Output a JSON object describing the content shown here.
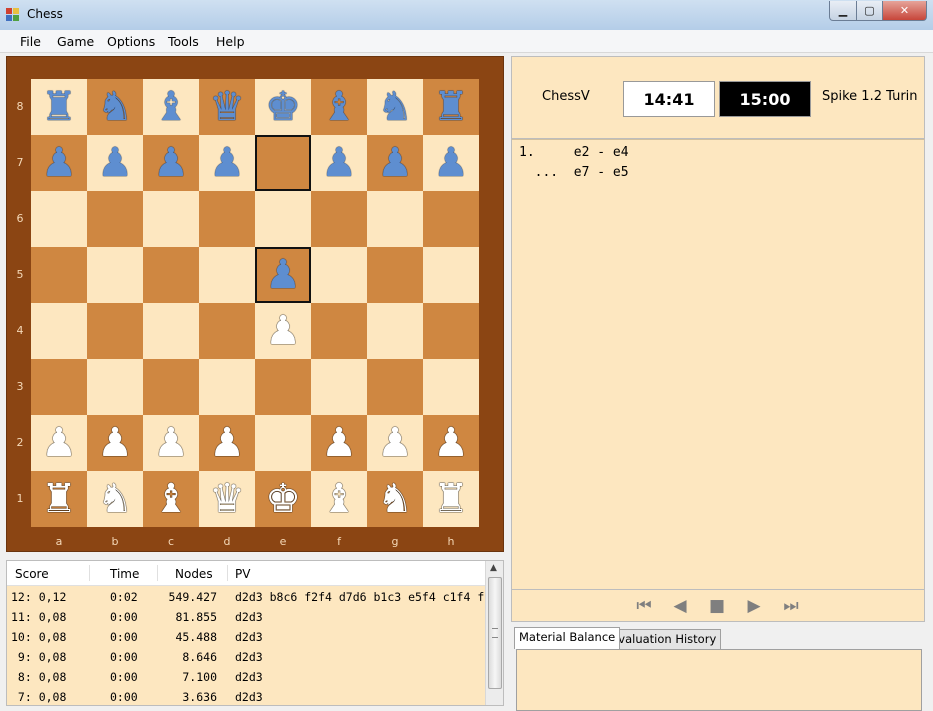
{
  "window": {
    "title": "Chess",
    "min_glyph": "▁",
    "max_glyph": "▢",
    "close_glyph": "✕"
  },
  "menu": [
    "File",
    "Game",
    "Options",
    "Tools",
    "Help"
  ],
  "board": {
    "ranks": [
      "8",
      "7",
      "6",
      "5",
      "4",
      "3",
      "2",
      "1"
    ],
    "files": [
      "a",
      "b",
      "c",
      "d",
      "e",
      "f",
      "g",
      "h"
    ],
    "colors": {
      "light": "#fde7c0",
      "dark": "#cf8741",
      "frame": "#8b4513",
      "black_piece": "#5e8ed0",
      "white_piece": "#ffffff"
    },
    "highlighted": [
      "e7",
      "e5"
    ],
    "pieces": {
      "a8": "b-rook",
      "b8": "b-knight",
      "c8": "b-bishop",
      "d8": "b-queen",
      "e8": "b-king",
      "f8": "b-bishop",
      "g8": "b-knight",
      "h8": "b-rook",
      "a7": "b-pawn",
      "b7": "b-pawn",
      "c7": "b-pawn",
      "d7": "b-pawn",
      "f7": "b-pawn",
      "g7": "b-pawn",
      "h7": "b-pawn",
      "e5": "b-pawn",
      "e4": "w-pawn",
      "a2": "w-pawn",
      "b2": "w-pawn",
      "c2": "w-pawn",
      "d2": "w-pawn",
      "f2": "w-pawn",
      "g2": "w-pawn",
      "h2": "w-pawn",
      "a1": "w-rook",
      "b1": "w-knight",
      "c1": "w-bishop",
      "d1": "w-queen",
      "e1": "w-king",
      "f1": "w-bishop",
      "g1": "w-knight",
      "h1": "w-rook"
    },
    "glyphs": {
      "king": "♚",
      "queen": "♛",
      "rook": "♜",
      "bishop": "♝",
      "knight": "♞",
      "pawn": "♟"
    }
  },
  "clocks": {
    "white_name": "ChessV",
    "white_time": "14:41",
    "black_time": "15:00",
    "black_name": "Spike 1.2 Turin"
  },
  "moves": [
    "1.     e2 - e4",
    "  ...  e7 - e5"
  ],
  "nav": [
    "⏮",
    "◀",
    "■",
    "▶",
    "⏭"
  ],
  "tabs": [
    "Material Balance",
    "Evaluation History"
  ],
  "analysis": {
    "headers": [
      "Score",
      "Time",
      "Nodes",
      "PV"
    ],
    "rows": [
      [
        "12: 0,12",
        "0:02",
        "549.427",
        "d2d3 b8c6 f2f4 d7d6 b1c3 e5f4 c1f4 f"
      ],
      [
        "11: 0,08",
        "0:00",
        "81.855",
        "d2d3"
      ],
      [
        "10: 0,08",
        "0:00",
        "45.488",
        "d2d3"
      ],
      [
        " 9: 0,08",
        "0:00",
        "8.646",
        "d2d3"
      ],
      [
        " 8: 0,08",
        "0:00",
        "7.100",
        "d2d3"
      ],
      [
        " 7: 0,08",
        "0:00",
        "3.636",
        "d2d3"
      ]
    ]
  }
}
